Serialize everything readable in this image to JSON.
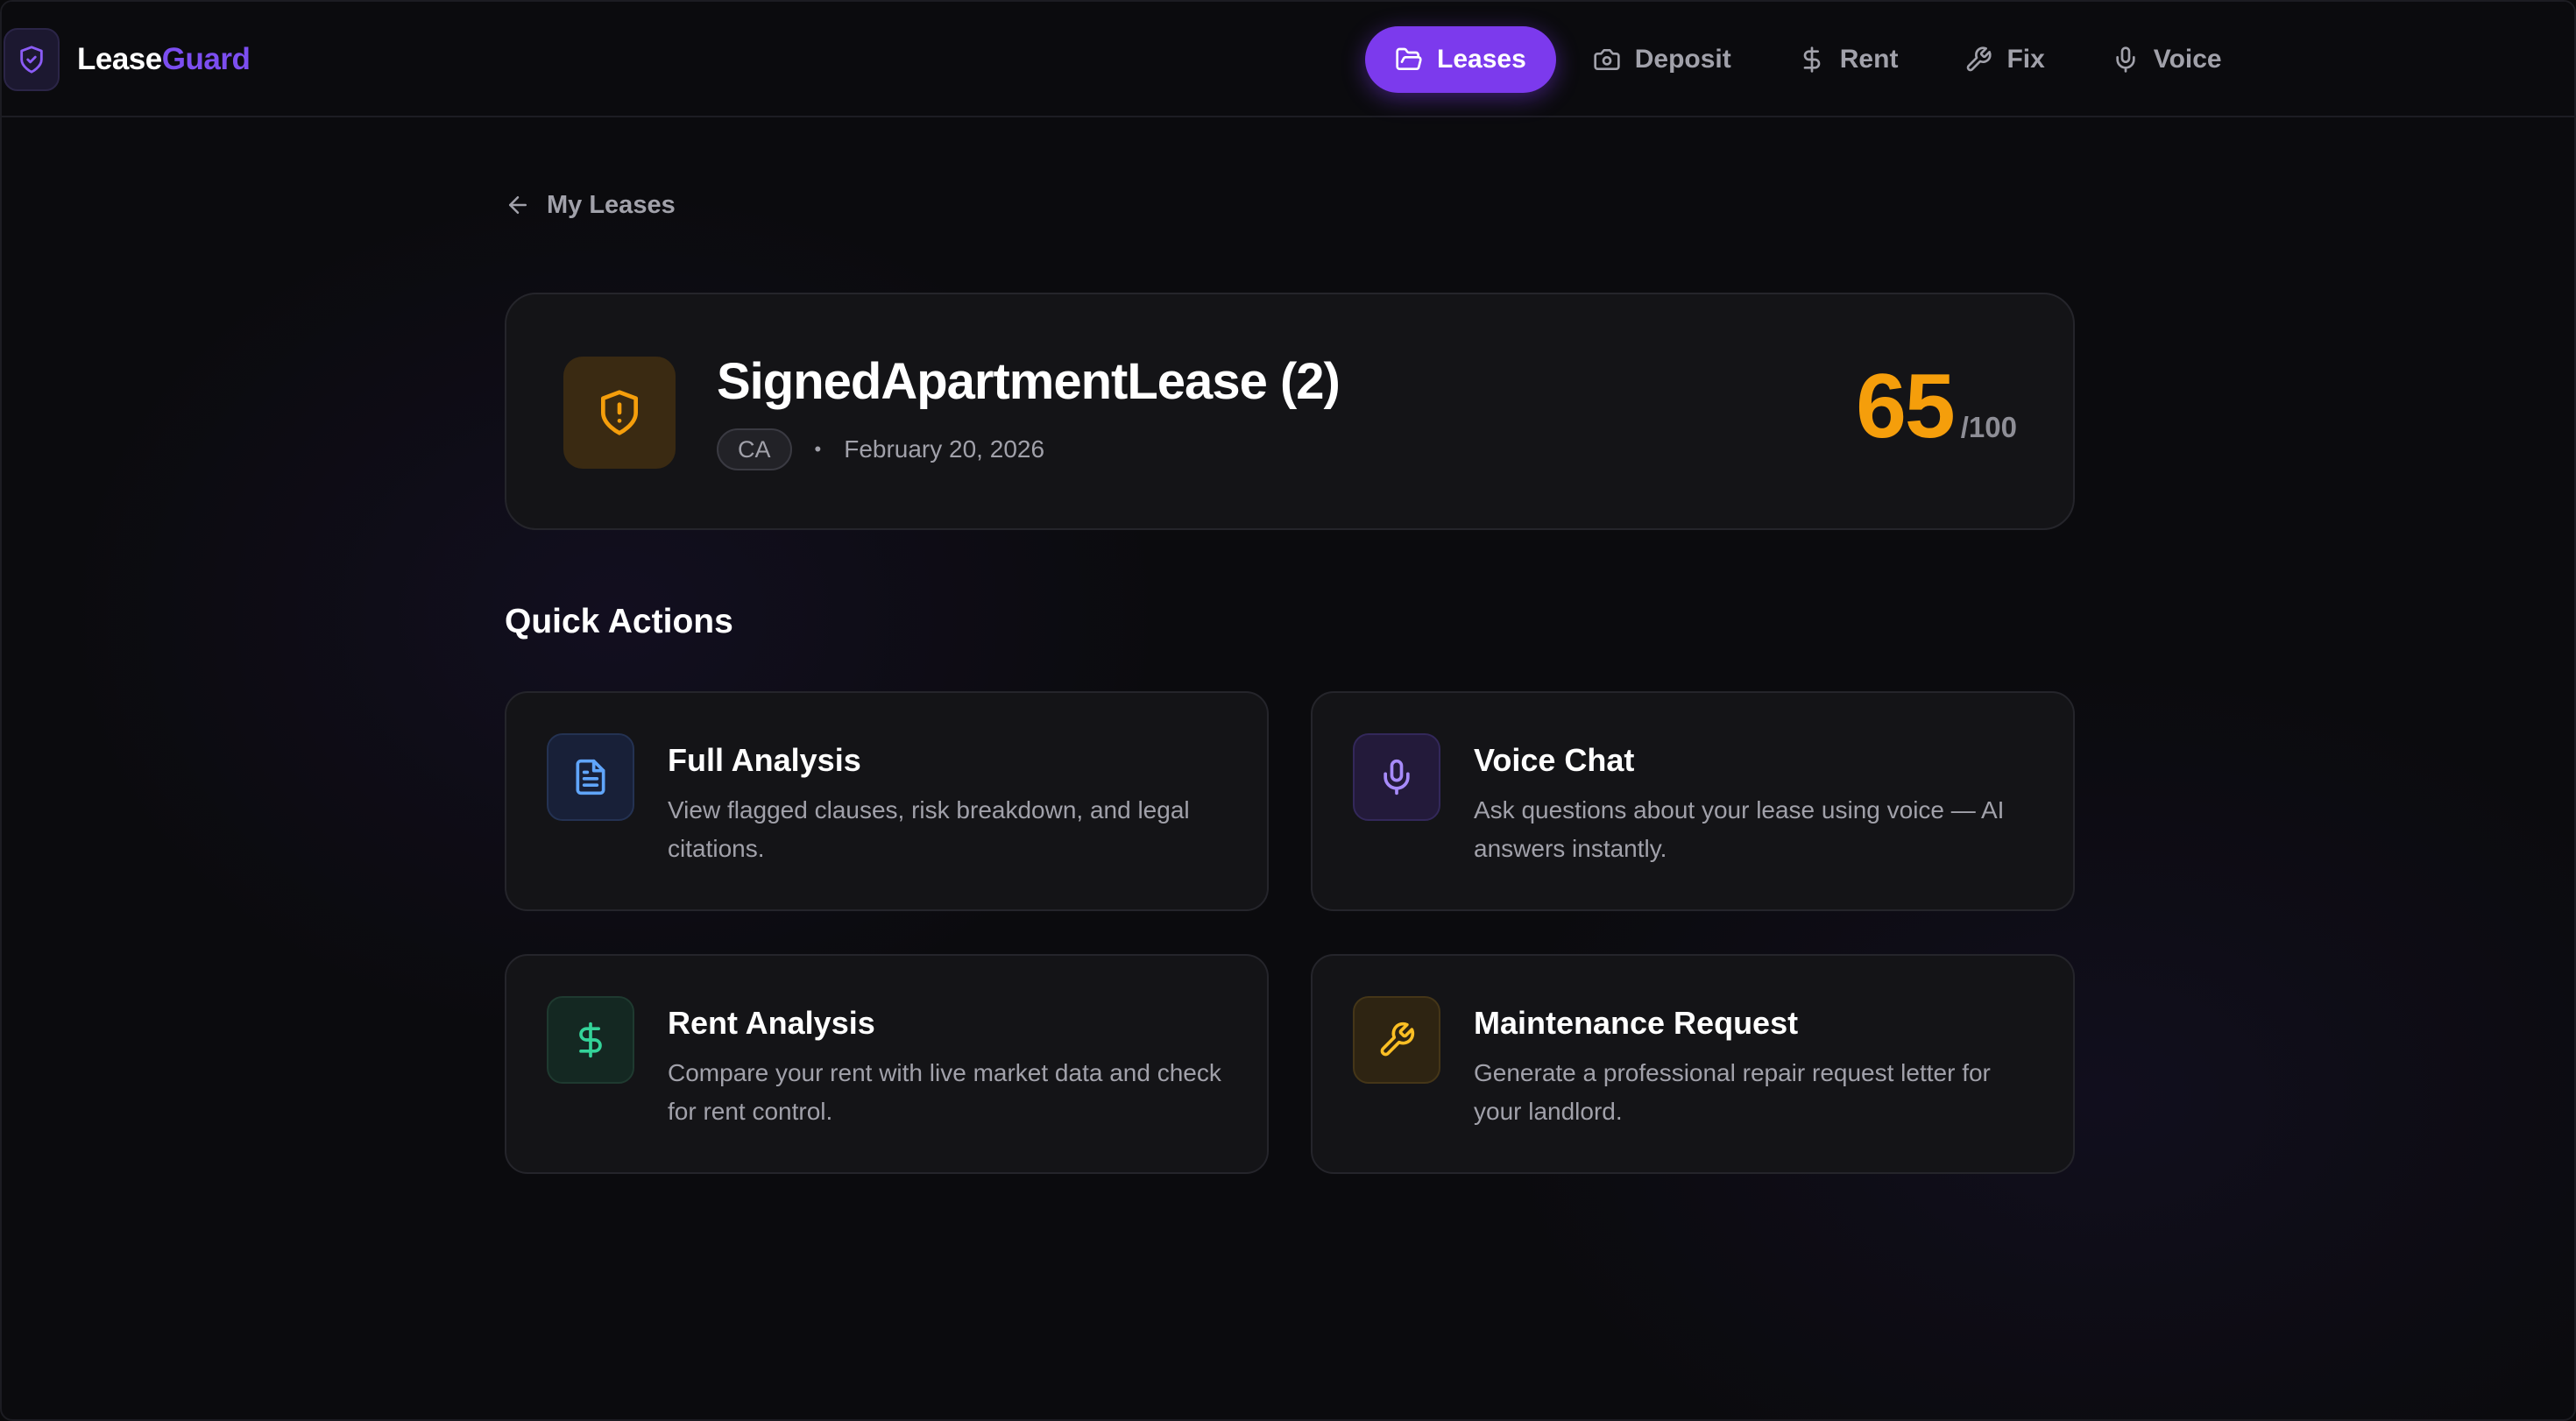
{
  "app": {
    "name_part1": "Lease",
    "name_part2": "Guard",
    "brand_icon": "shield-check-icon",
    "accent_color": "#7c3aed"
  },
  "nav": {
    "items": [
      {
        "label": "Leases",
        "icon": "folder-open-icon",
        "active": true
      },
      {
        "label": "Deposit",
        "icon": "camera-icon",
        "active": false
      },
      {
        "label": "Rent",
        "icon": "dollar-icon",
        "active": false
      },
      {
        "label": "Fix",
        "icon": "wrench-icon",
        "active": false
      },
      {
        "label": "Voice",
        "icon": "mic-icon",
        "active": false
      }
    ]
  },
  "back_link": {
    "label": "My Leases",
    "icon": "arrow-left-icon"
  },
  "lease": {
    "title": "SignedApartmentLease (2)",
    "state": "CA",
    "separator": "•",
    "date": "February 20, 2026",
    "score": "65",
    "score_max": "/100",
    "score_color": "#f59e0b",
    "icon": "shield-alert-icon"
  },
  "quick_actions": {
    "title": "Quick Actions",
    "items": [
      {
        "title": "Full Analysis",
        "description": "View flagged clauses, risk breakdown, and legal citations.",
        "icon": "file-text-icon",
        "color": "#60a5fa"
      },
      {
        "title": "Voice Chat",
        "description": "Ask questions about your lease using voice — AI answers instantly.",
        "icon": "mic-icon",
        "color": "#a78bfa"
      },
      {
        "title": "Rent Analysis",
        "description": "Compare your rent with live market data and check for rent control.",
        "icon": "dollar-icon",
        "color": "#34d399"
      },
      {
        "title": "Maintenance Request",
        "description": "Generate a professional repair request letter for your landlord.",
        "icon": "wrench-icon",
        "color": "#fbbf24"
      }
    ]
  }
}
